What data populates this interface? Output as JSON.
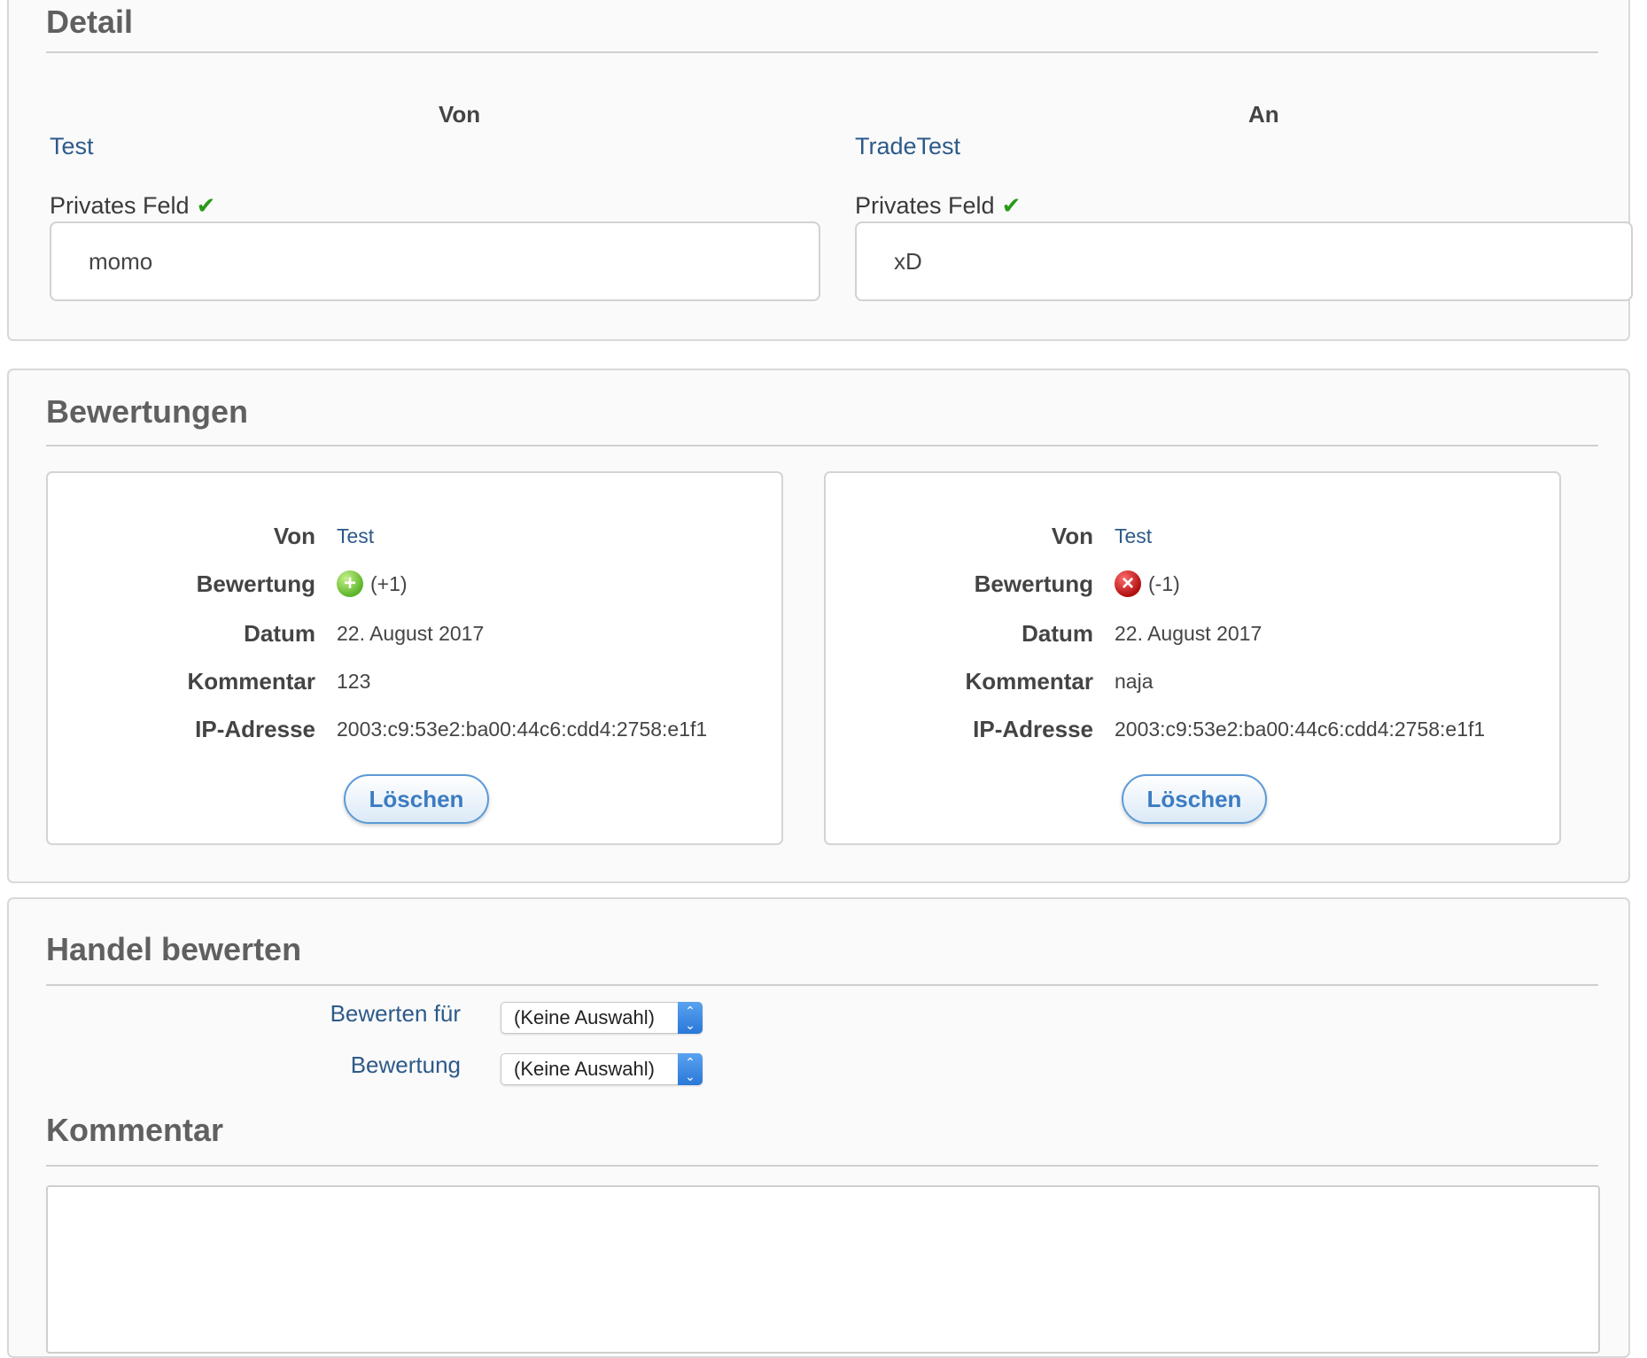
{
  "detail": {
    "title": "Detail",
    "from_heading": "Von",
    "to_heading": "An",
    "from_user": "Test",
    "to_user": "TradeTest",
    "private_field_label": "Privates Feld",
    "from_private_value": "momo",
    "to_private_value": "xD",
    "check_icon": "✔"
  },
  "ratings": {
    "title": "Bewertungen",
    "labels": {
      "from": "Von",
      "rating": "Bewertung",
      "date": "Datum",
      "comment": "Kommentar",
      "ip": "IP-Adresse"
    },
    "items": [
      {
        "from": "Test",
        "rating_icon": "plus-circle-icon",
        "rating_text": "(+1)",
        "date": "22. August 2017",
        "comment": "123",
        "ip": "2003:c9:53e2:ba00:44c6:cdd4:2758:e1f1",
        "delete_label": "Löschen"
      },
      {
        "from": "Test",
        "rating_icon": "x-circle-icon",
        "rating_text": "(-1)",
        "date": "22. August 2017",
        "comment": "naja",
        "ip": "2003:c9:53e2:ba00:44c6:cdd4:2758:e1f1",
        "delete_label": "Löschen"
      }
    ]
  },
  "rate_trade": {
    "title": "Handel bewerten",
    "rate_for_label": "Bewerten für",
    "rate_for_value": "(Keine Auswahl)",
    "rating_label": "Bewertung",
    "rating_value": "(Keine Auswahl)",
    "comment_title": "Kommentar",
    "comment_value": ""
  },
  "colors": {
    "link": "#2d5a8a",
    "check": "#2a9a1a",
    "positive": "#5cb52a",
    "negative": "#b01010",
    "button": "#3b7cc2"
  }
}
